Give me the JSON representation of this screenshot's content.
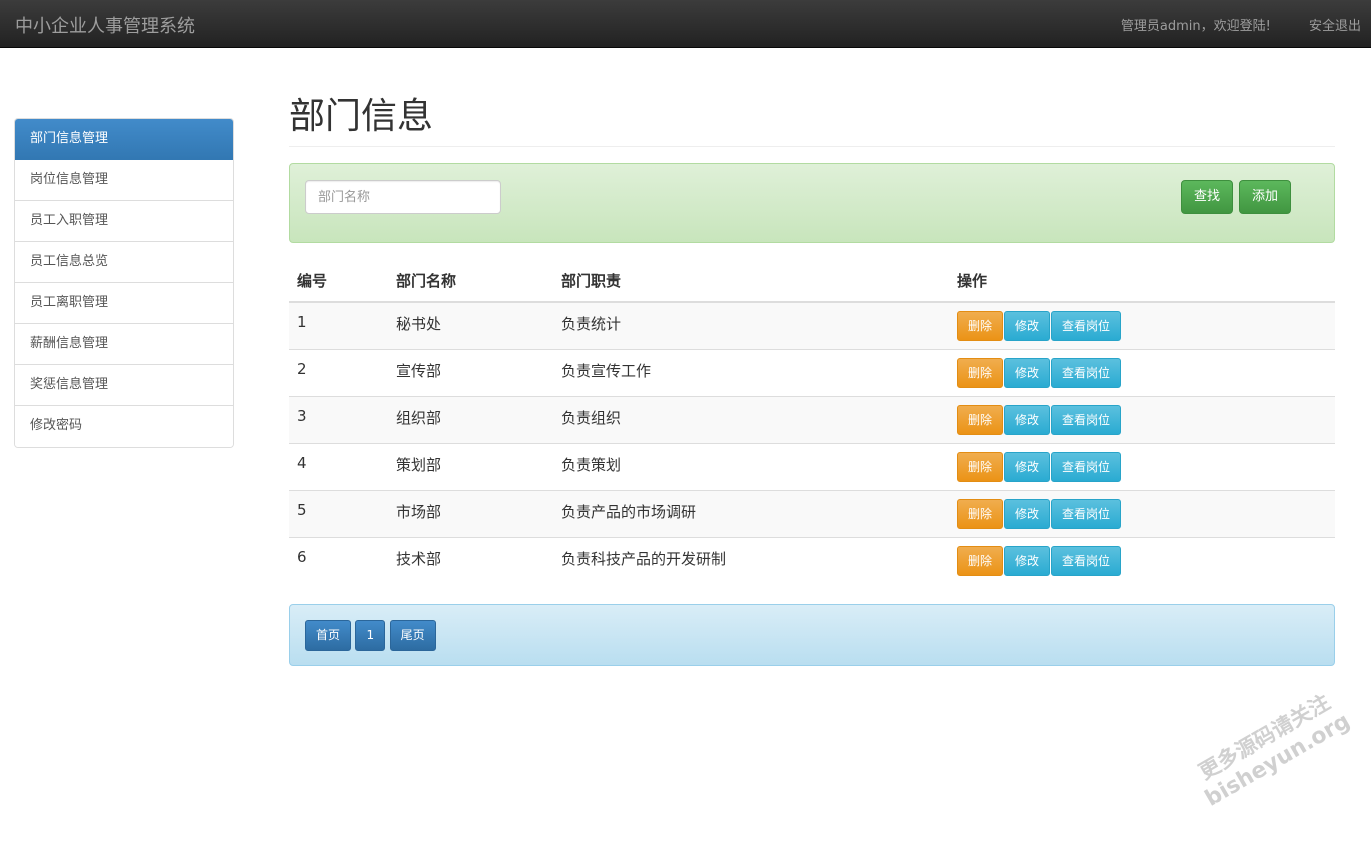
{
  "app": {
    "brand": "中小企业人事管理系统",
    "welcome": "管理员admin，欢迎登陆!",
    "logout": "安全退出"
  },
  "sidebar": {
    "items": [
      {
        "label": "部门信息管理",
        "active": true
      },
      {
        "label": "岗位信息管理"
      },
      {
        "label": "员工入职管理"
      },
      {
        "label": "员工信息总览"
      },
      {
        "label": "员工离职管理"
      },
      {
        "label": "薪酬信息管理"
      },
      {
        "label": "奖惩信息管理"
      },
      {
        "label": "修改密码"
      }
    ]
  },
  "main": {
    "title": "部门信息",
    "search": {
      "placeholder": "部门名称",
      "value": "",
      "find_label": "查找",
      "add_label": "添加"
    },
    "table": {
      "headers": [
        "编号",
        "部门名称",
        "部门职责",
        "操作"
      ],
      "rows": [
        {
          "id": "1",
          "name": "秘书处",
          "duty": "负责统计"
        },
        {
          "id": "2",
          "name": "宣传部",
          "duty": "负责宣传工作"
        },
        {
          "id": "3",
          "name": "组织部",
          "duty": "负责组织"
        },
        {
          "id": "4",
          "name": "策划部",
          "duty": "负责策划"
        },
        {
          "id": "5",
          "name": "市场部",
          "duty": "负责产品的市场调研"
        },
        {
          "id": "6",
          "name": "技术部",
          "duty": "负责科技产品的开发研制"
        }
      ],
      "actions": {
        "delete": "删除",
        "edit": "修改",
        "view_positions": "查看岗位"
      }
    },
    "pager": {
      "first": "首页",
      "page": "1",
      "last": "尾页"
    }
  },
  "watermark": {
    "line1": "更多源码请关注",
    "line2": "bisheyun.org"
  }
}
